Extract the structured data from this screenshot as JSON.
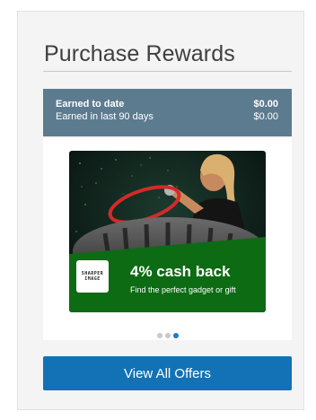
{
  "widget": {
    "title": "Purchase Rewards"
  },
  "earnings": {
    "to_date_label": "Earned to date",
    "to_date_value": "$0.00",
    "last90_label": "Earned in last 90 days",
    "last90_value": "$0.00"
  },
  "promo": {
    "logo_line1": "SHARPER",
    "logo_line2": "IMAGE",
    "headline": "4% cash back",
    "subline": "Find the perfect gadget or gift",
    "slide_count": 3,
    "active_slide": 3
  },
  "cta": {
    "label": "View All Offers"
  },
  "colors": {
    "earnings_bg": "#5d7b8f",
    "promo_green": "#0d6b14",
    "cta_blue": "#1272b5",
    "dot_active": "#1b7cc4",
    "dot_inactive": "#c8c8c8"
  }
}
